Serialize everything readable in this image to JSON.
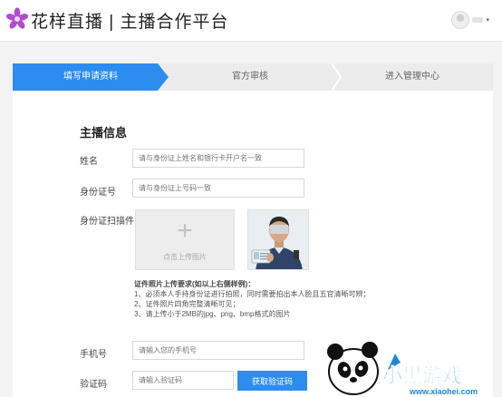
{
  "header": {
    "brand": "花样直播 | 主播合作平台"
  },
  "steps": [
    {
      "label": "填写申请资料",
      "active": true
    },
    {
      "label": "官方审核",
      "active": false
    },
    {
      "label": "进入管理中心",
      "active": false
    }
  ],
  "form": {
    "section_title": "主播信息",
    "name_label": "姓名",
    "name_placeholder": "请与身份证上姓名和银行卡开户名一致",
    "id_label": "身份证号",
    "id_placeholder": "请与身份证上号码一致",
    "scan_label": "身份证扫描件",
    "upload_text": "点击上传图片",
    "requirements": {
      "title": "证件照片上传要求(如以上右侧样例)：",
      "items": [
        "1、必须本人手持身份证进行拍照，同时需要拍出本人脸且五官清晰可辨；",
        "2、证件照片四角完整清晰可见；",
        "3、请上传小于2MB的jpg、png、bmp格式的图片"
      ]
    },
    "phone_label": "手机号",
    "phone_placeholder": "请输入您的手机号",
    "code_label": "验证码",
    "code_placeholder": "请输入验证码",
    "code_button": "获取验证码"
  },
  "watermark": {
    "title": "小黑游戏",
    "url": "www.xiaohei.com"
  },
  "colors": {
    "accent": "#2d8cf0",
    "logo": "#b04cd0"
  }
}
